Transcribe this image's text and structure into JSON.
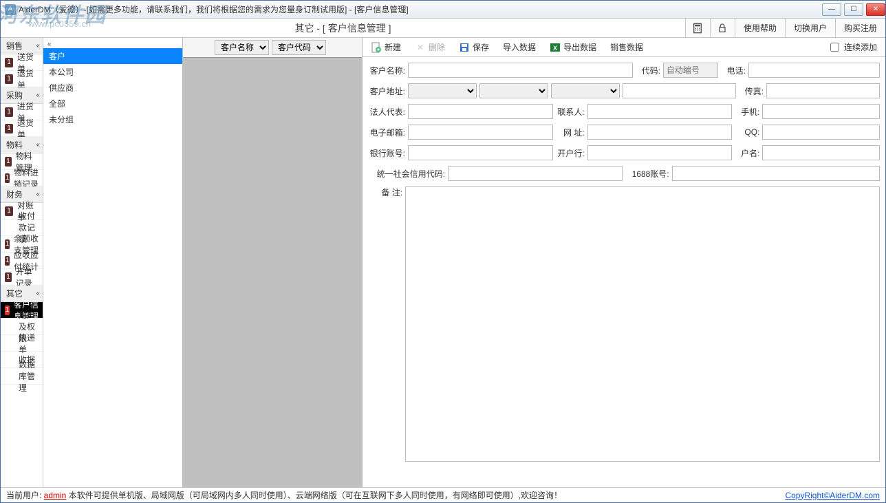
{
  "watermark": {
    "main": "河东软件园",
    "sub": "www.pc0359.cn"
  },
  "titlebar": {
    "title": "AiderDM（爱德）-[如需更多功能，请联系我们，我们将根据您的需求为您量身订制试用版] - [客户信息管理]"
  },
  "topbar": {
    "breadcrumb": "其它 - [ 客户信息管理 ]",
    "buttons": {
      "help": "使用帮助",
      "switch_user": "切换用户",
      "buy": "购买注册"
    }
  },
  "sidebar": {
    "sections": [
      {
        "head": "销售",
        "items": [
          {
            "label": "送货单"
          },
          {
            "label": "退货单"
          }
        ]
      },
      {
        "head": "采购",
        "items": [
          {
            "label": "进货单"
          },
          {
            "label": "退货单"
          }
        ]
      },
      {
        "head": "物料",
        "items": [
          {
            "label": "物料管理"
          },
          {
            "label": "物料进销记录"
          }
        ]
      },
      {
        "head": "财务",
        "items": [
          {
            "label": "对账单"
          },
          {
            "label": "收付款记录",
            "sub": true
          },
          {
            "label": "余额收支管理"
          },
          {
            "label": "应收应付统计"
          },
          {
            "label": "开单记录"
          }
        ]
      },
      {
        "head": "其它",
        "items": [
          {
            "label": "客户信息管理",
            "active": true
          },
          {
            "label": "用户及权限",
            "sub": true
          },
          {
            "label": "快递单",
            "sub": true
          },
          {
            "label": "收据",
            "sub": true
          },
          {
            "label": "数据库管理",
            "sub": true
          }
        ]
      }
    ],
    "badge": "1"
  },
  "tree": {
    "items": [
      "客户",
      "本公司",
      "供应商",
      "全部",
      "未分组"
    ],
    "selected_index": 0
  },
  "list": {
    "headers": {
      "name": "客户名称",
      "code": "客户代码"
    }
  },
  "form_toolbar": {
    "new": "新建",
    "delete": "删除",
    "save": "保存",
    "import": "导入数据",
    "export": "导出数据",
    "sales": "销售数据",
    "continuous": "连续添加"
  },
  "form": {
    "labels": {
      "name": "客户名称:",
      "code": "代码:",
      "code_placeholder": "自动编号",
      "phone": "电话:",
      "address": "客户地址:",
      "fax": "传真:",
      "legal": "法人代表:",
      "contact": "联系人:",
      "mobile": "手机:",
      "email": "电子邮箱:",
      "website": "网    址:",
      "qq": "QQ:",
      "bank": "银行账号:",
      "bank_branch": "开户行:",
      "account_name": "户名:",
      "uscc": "统一社会信用代码:",
      "acct_1688": "1688账号:",
      "remark": "备     注:"
    }
  },
  "statusbar": {
    "prefix": "当前用户: ",
    "user": "admin",
    "text": " 本软件可提供单机版、局域网版（可局域网内多人同时使用）、云端网络版（可在互联网下多人同时使用，有网络即可使用）,欢迎咨询！",
    "copy": "CopyRight©AiderDM.com"
  }
}
